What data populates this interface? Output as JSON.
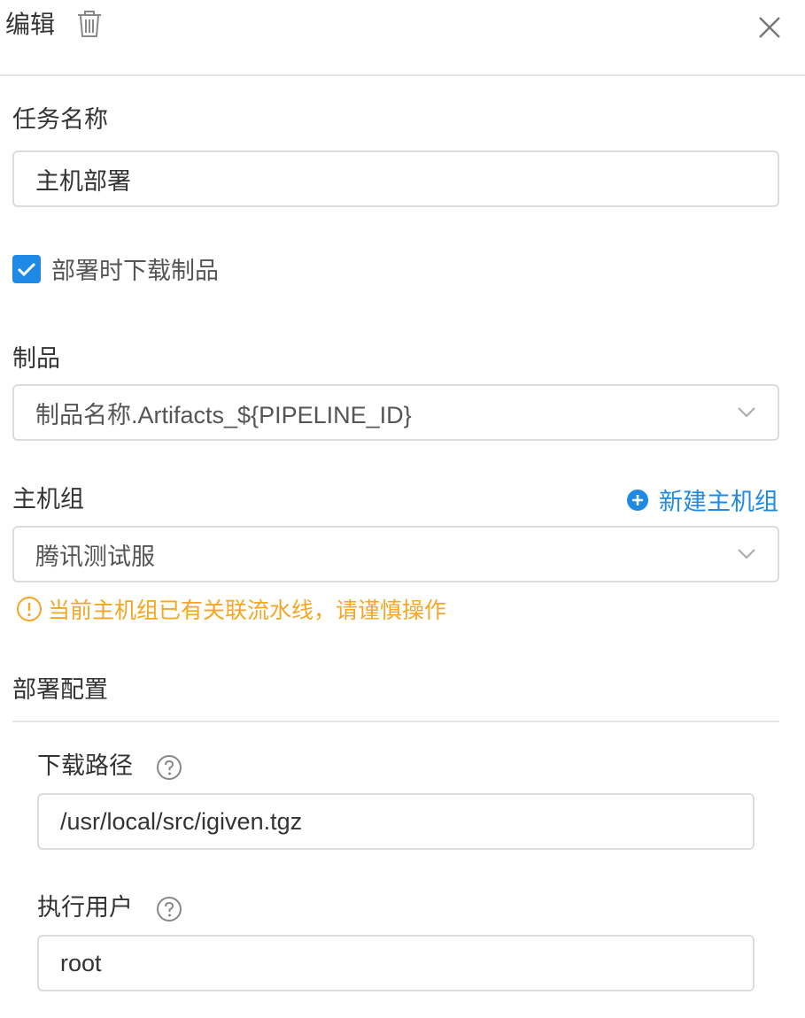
{
  "header": {
    "title": "编辑",
    "delete_icon": "trash-icon",
    "close_icon": "close-icon"
  },
  "task_name": {
    "label": "任务名称",
    "value": "主机部署"
  },
  "download_checkbox": {
    "checked": true,
    "label": "部署时下载制品"
  },
  "artifact": {
    "label": "制品",
    "selected": "制品名称.Artifacts_${PIPELINE_ID}"
  },
  "host_group": {
    "label": "主机组",
    "new_button": "新建主机组",
    "selected": "腾讯测试服",
    "warning": "当前主机组已有关联流水线，请谨慎操作"
  },
  "deploy_config": {
    "section_title": "部署配置",
    "download_path": {
      "label": "下载路径",
      "value": "/usr/local/src/igiven.tgz"
    },
    "exec_user": {
      "label": "执行用户",
      "value": "root"
    }
  },
  "colors": {
    "accent": "#1e8ae6",
    "warning": "#f5a623",
    "border": "#dcdcdc"
  }
}
